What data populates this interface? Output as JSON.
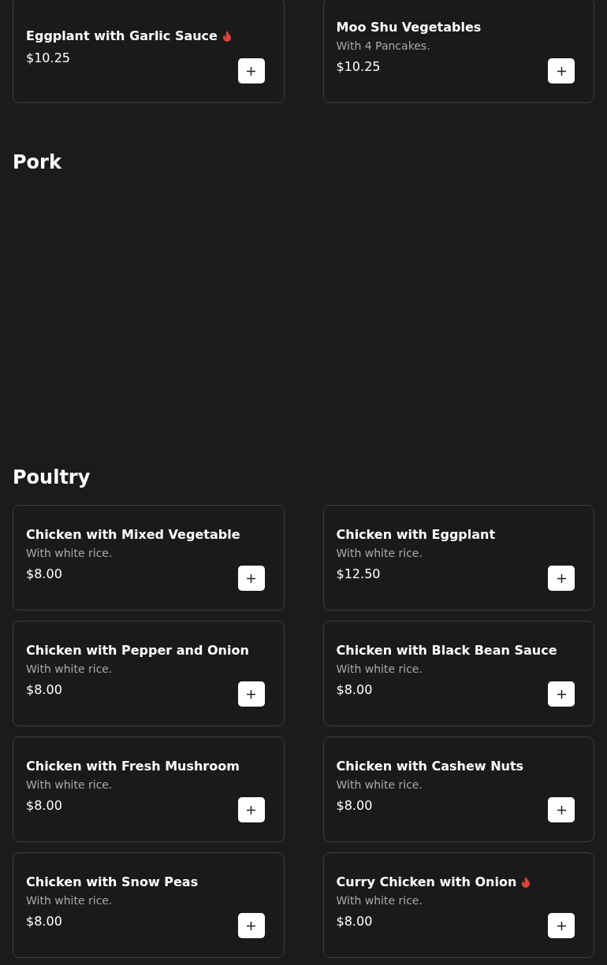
{
  "sections": [
    {
      "items": [
        {
          "name": "Eggplant with Garlic Sauce",
          "spicy": true,
          "price": "$10.25"
        },
        {
          "name": "Moo Shu Vegetables",
          "spicy": false,
          "description": "With 4 Pancakes.",
          "price": "$10.25"
        }
      ]
    },
    {
      "title": "Pork"
    },
    {
      "title": "Poultry",
      "items": [
        {
          "name": "Chicken with Mixed Vegetable",
          "spicy": false,
          "description": "With white rice.",
          "price": "$8.00"
        },
        {
          "name": "Chicken with Eggplant",
          "spicy": false,
          "description": "With white rice.",
          "price": "$12.50"
        },
        {
          "name": "Chicken with Pepper and Onion",
          "spicy": false,
          "description": "With white rice.",
          "price": "$8.00"
        },
        {
          "name": "Chicken with Black Bean Sauce",
          "spicy": false,
          "description": "With white rice.",
          "price": "$8.00"
        },
        {
          "name": "Chicken with Fresh Mushroom",
          "spicy": false,
          "description": "With white rice.",
          "price": "$8.00"
        },
        {
          "name": "Chicken with Cashew Nuts",
          "spicy": false,
          "description": "With white rice.",
          "price": "$8.00"
        },
        {
          "name": "Chicken with Snow Peas",
          "spicy": false,
          "description": "With white rice.",
          "price": "$8.00"
        },
        {
          "name": "Curry Chicken with Onion",
          "spicy": true,
          "description": "With white rice.",
          "price": "$8.00"
        }
      ]
    }
  ]
}
